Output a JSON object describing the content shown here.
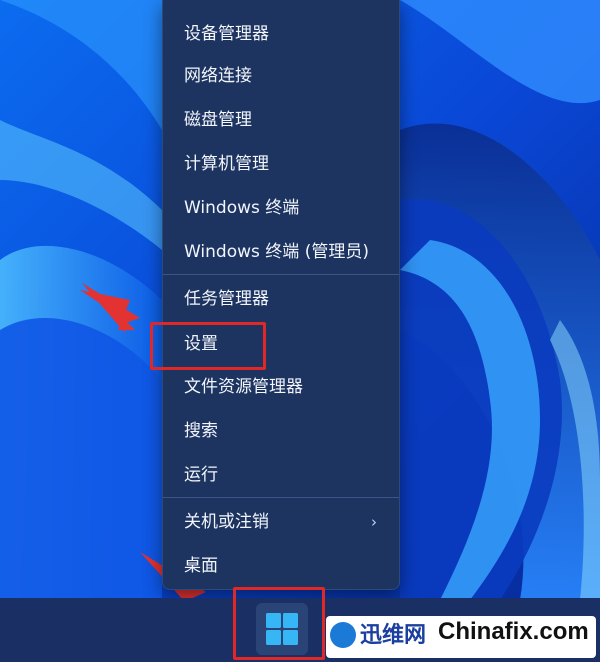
{
  "context_menu": {
    "items": [
      {
        "label": "设备管理器"
      },
      {
        "label": "网络连接"
      },
      {
        "label": "磁盘管理"
      },
      {
        "label": "计算机管理"
      },
      {
        "label": "Windows 终端"
      },
      {
        "label": "Windows 终端 (管理员)"
      },
      {
        "label": "任务管理器"
      },
      {
        "label": "设置"
      },
      {
        "label": "文件资源管理器"
      },
      {
        "label": "搜索"
      },
      {
        "label": "运行"
      },
      {
        "label": "关机或注销"
      },
      {
        "label": "桌面"
      }
    ],
    "submenu_chevron": "›"
  },
  "watermark": {
    "brand_cn": "迅维网",
    "brand_en": "Chinafix.com"
  },
  "colors": {
    "highlight": "#e02828",
    "menu_bg": "#1d3460",
    "taskbar_bg": "#1a3064",
    "windows_logo": "#37b6f6"
  }
}
